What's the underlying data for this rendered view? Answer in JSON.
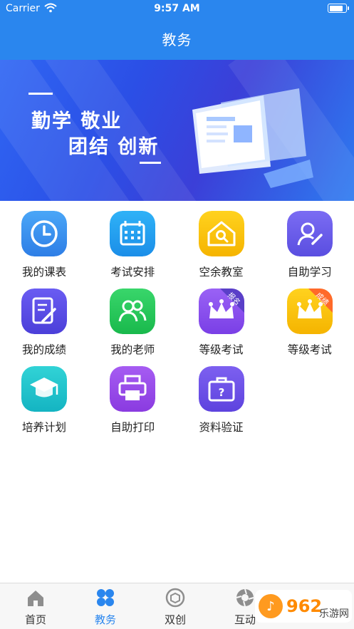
{
  "status_bar": {
    "carrier": "Carrier",
    "time": "9:57 AM"
  },
  "nav": {
    "title": "教务"
  },
  "banner": {
    "line1": "勤学  敬业",
    "line2": "团结  创新"
  },
  "grid": [
    {
      "label": "我的课表",
      "icon": "clock-icon",
      "colors": [
        "#4aa6f7",
        "#2e7ee6"
      ],
      "badge": ""
    },
    {
      "label": "考试安排",
      "icon": "calendar-icon",
      "colors": [
        "#2fb2f7",
        "#1b8ee8"
      ],
      "badge": ""
    },
    {
      "label": "空余教室",
      "icon": "house-search-icon",
      "colors": [
        "#ffd21e",
        "#f5b400"
      ],
      "badge": ""
    },
    {
      "label": "自助学习",
      "icon": "person-pen-icon",
      "colors": [
        "#7b6cf3",
        "#5a4ee0"
      ],
      "badge": ""
    },
    {
      "label": "我的成绩",
      "icon": "document-pen-icon",
      "colors": [
        "#6a5cf2",
        "#4b3fd9"
      ],
      "badge": ""
    },
    {
      "label": "我的老师",
      "icon": "people-icon",
      "colors": [
        "#39d66b",
        "#19b94c"
      ],
      "badge": ""
    },
    {
      "label": "等级考试",
      "icon": "crown-icon",
      "colors": [
        "#9a62f5",
        "#7a3fe6"
      ],
      "badge": "报名"
    },
    {
      "label": "等级考试",
      "icon": "crown-icon",
      "colors": [
        "#ffd21e",
        "#f5b400"
      ],
      "badge": "成绩"
    },
    {
      "label": "培养计划",
      "icon": "graduation-cap-icon",
      "colors": [
        "#31d3d6",
        "#14b4c2"
      ],
      "badge": ""
    },
    {
      "label": "自助打印",
      "icon": "printer-icon",
      "colors": [
        "#a65cf2",
        "#8a3be0"
      ],
      "badge": ""
    },
    {
      "label": "资料验证",
      "icon": "briefcase-question-icon",
      "colors": [
        "#7d60f0",
        "#5d43de"
      ],
      "badge": ""
    }
  ],
  "badge_colors": {
    "报名": "#5a3fc8",
    "成绩": "#ff6a2a"
  },
  "tabs": [
    {
      "label": "首页",
      "icon": "home-icon",
      "active": false
    },
    {
      "label": "教务",
      "icon": "grid-icon",
      "active": true
    },
    {
      "label": "双创",
      "icon": "box-icon",
      "active": false
    },
    {
      "label": "互动",
      "icon": "aperture-icon",
      "active": false
    }
  ],
  "watermark": {
    "brand": "962",
    "site": "乐游网"
  },
  "colors": {
    "accent": "#2a86ee"
  }
}
